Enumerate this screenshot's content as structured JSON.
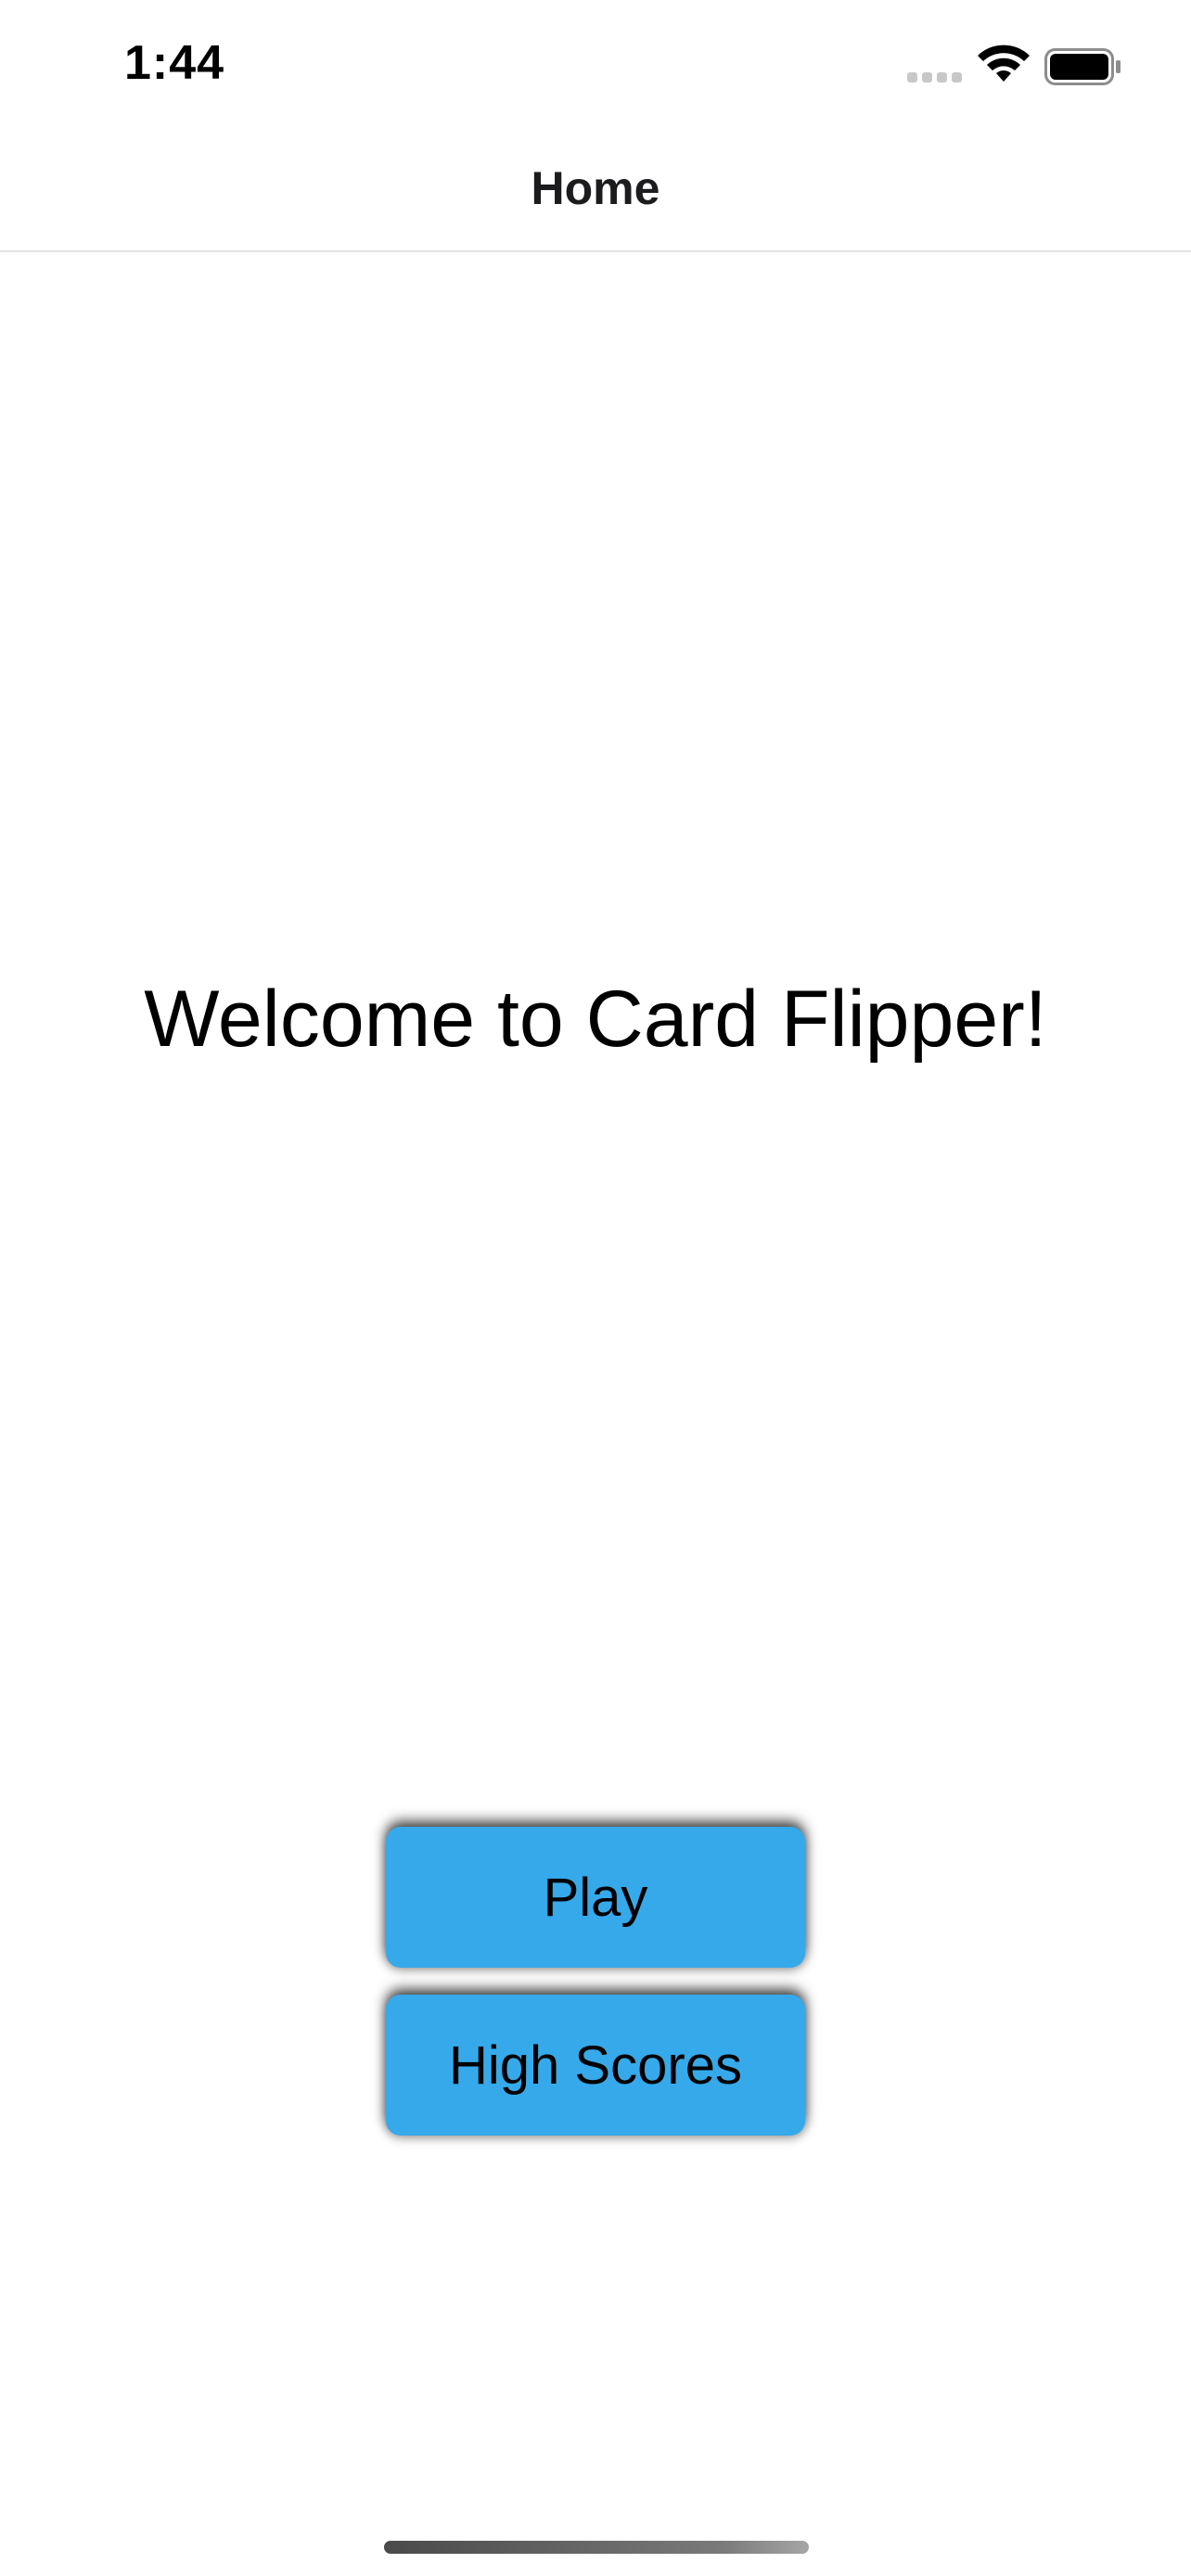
{
  "status_bar": {
    "time": "1:44",
    "icons": [
      "cellular-signal-icon",
      "wifi-icon",
      "battery-icon"
    ]
  },
  "nav": {
    "title": "Home"
  },
  "main": {
    "welcome_text": "Welcome to Card Flipper!"
  },
  "buttons": {
    "play_label": "Play",
    "high_scores_label": "High Scores"
  },
  "colors": {
    "button_bg": "#36a9ea",
    "background": "#ffffff",
    "text": "#000000"
  }
}
